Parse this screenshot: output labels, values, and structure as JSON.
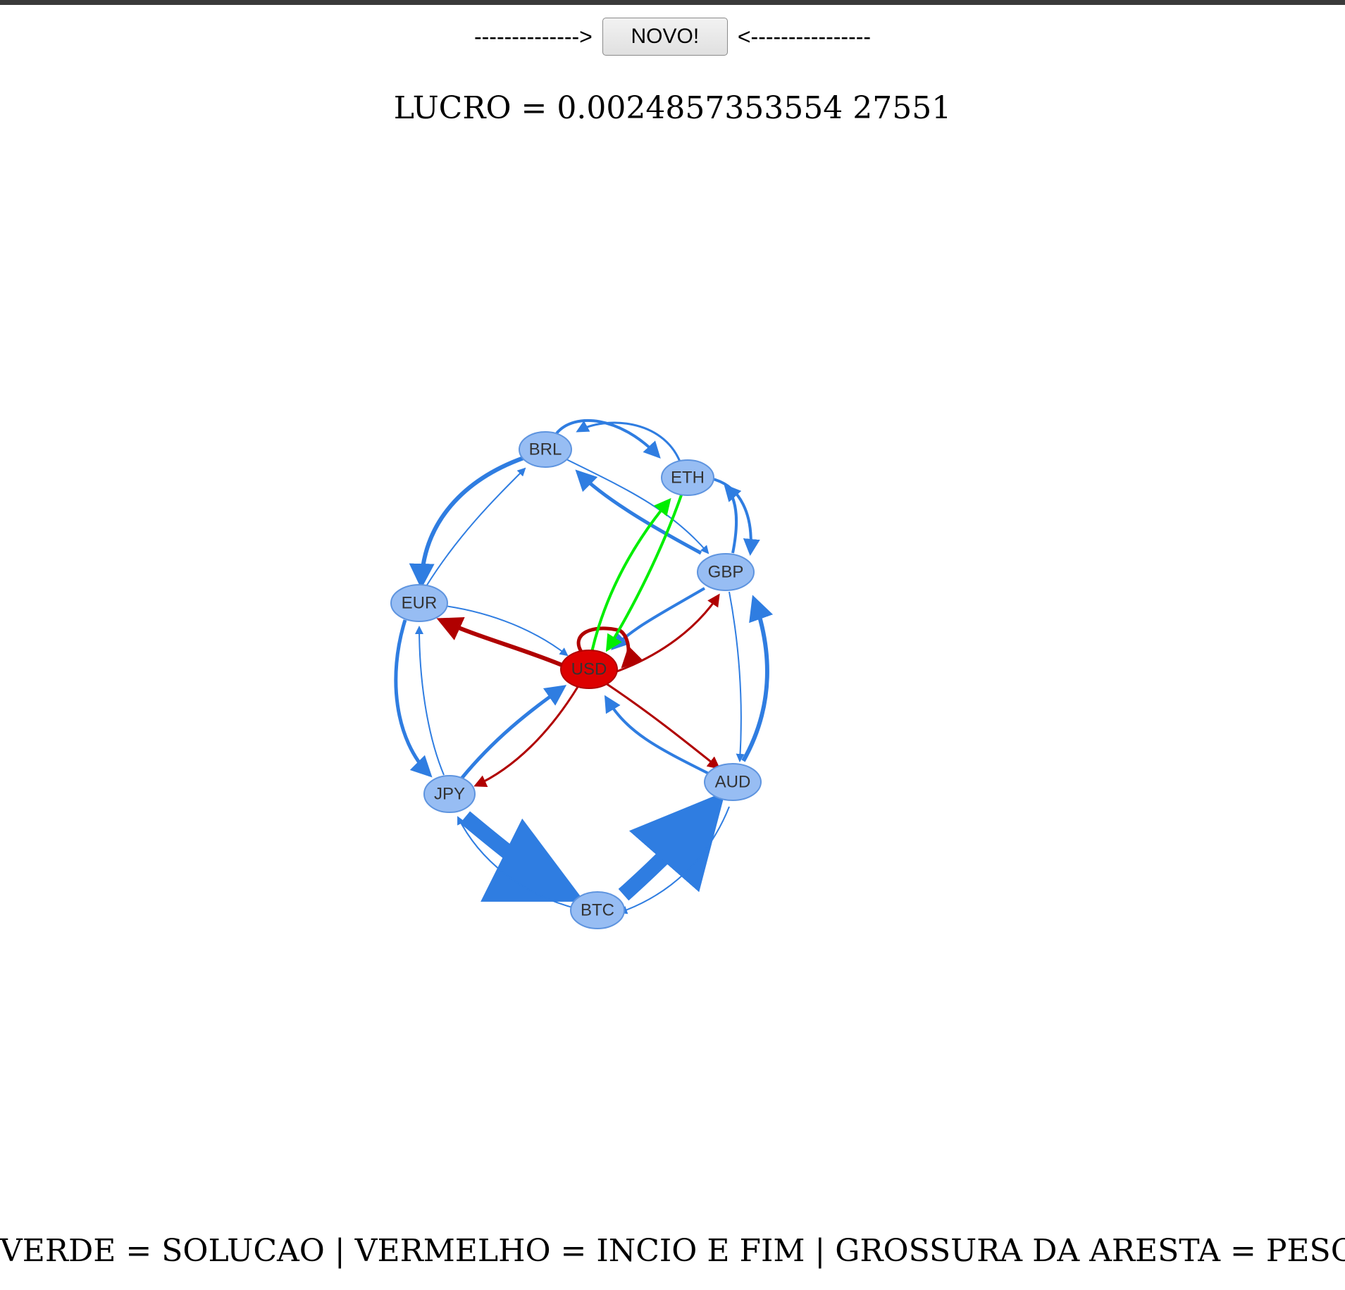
{
  "controls": {
    "left_arrow": "-------------->",
    "button_label": "NOVO!",
    "right_arrow": "<----------------"
  },
  "result": {
    "profit_text": "LUCRO = 0.0024857353554 27551"
  },
  "legend": {
    "text": "VERDE = SOLUCAO | VERMELHO = INCIO E FIM | GROSSURA DA ARESTA = PESO"
  },
  "colors": {
    "default_node": "#97bdf3",
    "default_edge": "#2f7de1",
    "start_end": "#cc0000",
    "solution": "#00ff00"
  },
  "graph": {
    "nodes": [
      {
        "id": "BRL",
        "label": "BRL",
        "role": "default"
      },
      {
        "id": "ETH",
        "label": "ETH",
        "role": "default"
      },
      {
        "id": "GBP",
        "label": "GBP",
        "role": "default"
      },
      {
        "id": "EUR",
        "label": "EUR",
        "role": "default"
      },
      {
        "id": "USD",
        "label": "USD",
        "role": "start_end"
      },
      {
        "id": "JPY",
        "label": "JPY",
        "role": "default"
      },
      {
        "id": "AUD",
        "label": "AUD",
        "role": "default"
      },
      {
        "id": "BTC",
        "label": "BTC",
        "role": "default"
      }
    ]
  }
}
